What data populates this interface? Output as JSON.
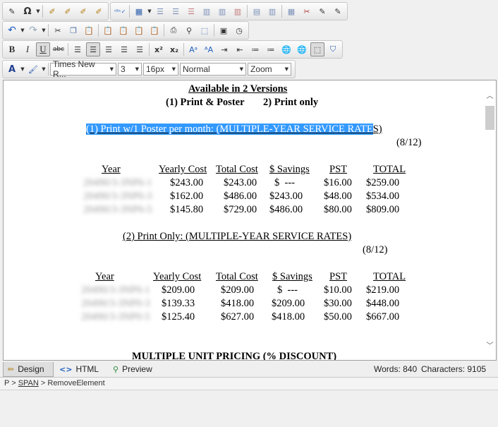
{
  "toolbar": {
    "font_color_label": "A",
    "font_name": "Times New R...",
    "font_size": "3",
    "size_px": "16px",
    "paragraph_style": "Normal",
    "zoom": "Zoom",
    "bold": "B",
    "italic": "I",
    "underline": "U",
    "strike": "abc",
    "superscript": "x²",
    "subscript": "x₂"
  },
  "document": {
    "heading1": "Available in 2 Versions",
    "heading2_a": "(1) Print & Poster",
    "heading2_b": "2) Print only",
    "section1_title_selected": "(1) Print w/1 Poster per month: (MULTIPLE-YEAR SERVICE RATE",
    "section1_title_rest": "S)",
    "section1_date": "(8/12)",
    "table_headers": [
      "Year",
      "Yearly Cost",
      "Total Cost",
      "$ Savings",
      "PST",
      "TOTAL"
    ],
    "table1_rows": [
      {
        "year": "20490/3-3NP6-1",
        "yearly": "$243.00",
        "total": "$243.00",
        "savings": "$  ---",
        "pst": "$16.00",
        "grand": "$259.00"
      },
      {
        "year": "20490/3-3NP6-3",
        "yearly": "$162.00",
        "total": "$486.00",
        "savings": "$243.00",
        "pst": "$48.00",
        "grand": "$534.00"
      },
      {
        "year": "20490/3-3NP6-5",
        "yearly": "$145.80",
        "total": "$729.00",
        "savings": "$486.00",
        "pst": "$80.00",
        "grand": "$809.00"
      }
    ],
    "section2_title": "(2) Print Only: (MULTIPLE-YEAR SERVICE RATES)",
    "section2_date": "(8/12)",
    "table2_rows": [
      {
        "year": "20490/3-3NP0-1",
        "yearly": "$209.00",
        "total": "$209.00",
        "savings": "$  ---",
        "pst": "$10.00",
        "grand": "$219.00"
      },
      {
        "year": "20490/3-3NP0-3",
        "yearly": "$139.33",
        "total": "$418.00",
        "savings": "$209.00",
        "pst": "$30.00",
        "grand": "$448.00"
      },
      {
        "year": "20490/3-3NP0-5",
        "yearly": "$125.40",
        "total": "$627.00",
        "savings": "$418.00",
        "pst": "$50.00",
        "grand": "$667.00"
      }
    ],
    "section3_title": "MULTIPLE UNIT PRICING (% DISCOUNT)"
  },
  "tabs": {
    "design": "Design",
    "html": "HTML",
    "preview": "Preview"
  },
  "status": {
    "words": "Words: 840",
    "characters": "Characters: 9105"
  },
  "path": {
    "p": "P",
    "sep": " > ",
    "span": "SPAN",
    "remove": "RemoveElement"
  },
  "colors": {
    "selection": "#3399ff",
    "editor_bg": "#ffffff",
    "chrome_bg": "#f0f0f0"
  }
}
